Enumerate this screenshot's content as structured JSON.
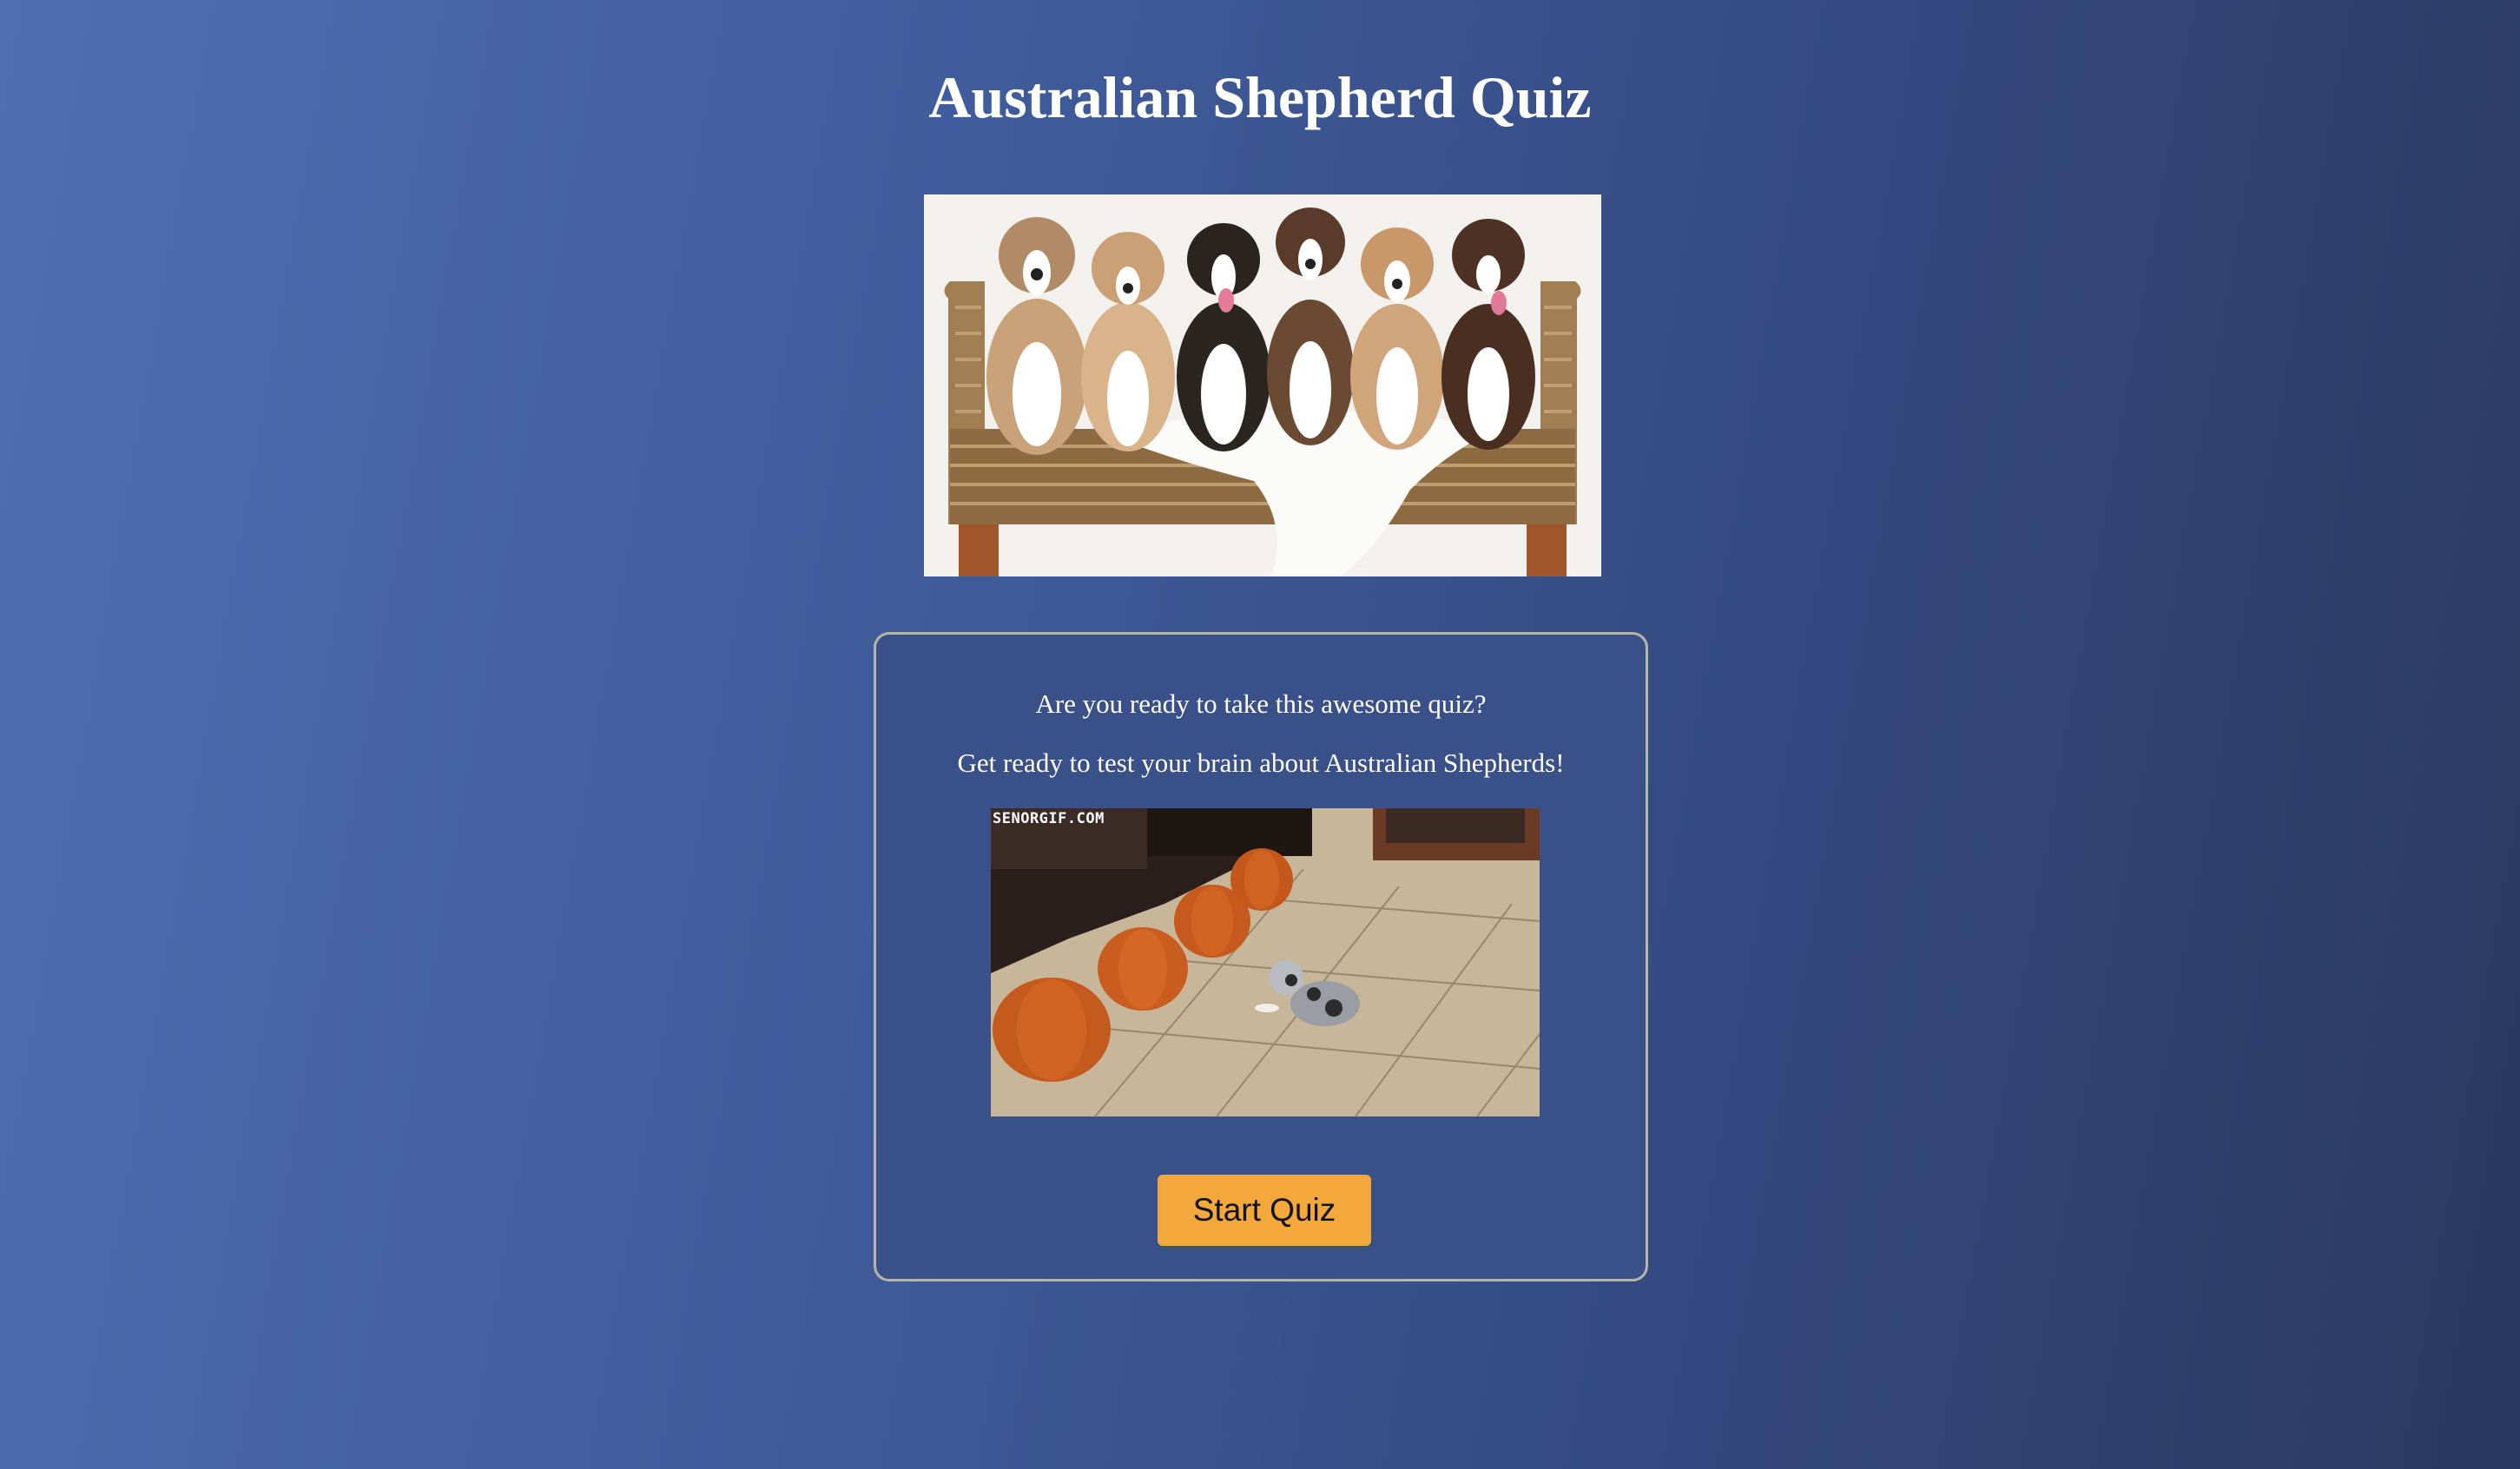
{
  "page": {
    "title": "Australian Shepherd Quiz"
  },
  "intro_card": {
    "line1": "Are you ready to take this awesome quiz?",
    "line2": "Get ready to test your brain about Australian Shepherds!",
    "gif_watermark": "SENORGIF.COM",
    "start_button_label": "Start Quiz"
  },
  "colors": {
    "accent_button": "#f2a83a",
    "background_start": "#4f6db3",
    "background_end": "#28395f",
    "card_border": "#b8b4a8"
  }
}
